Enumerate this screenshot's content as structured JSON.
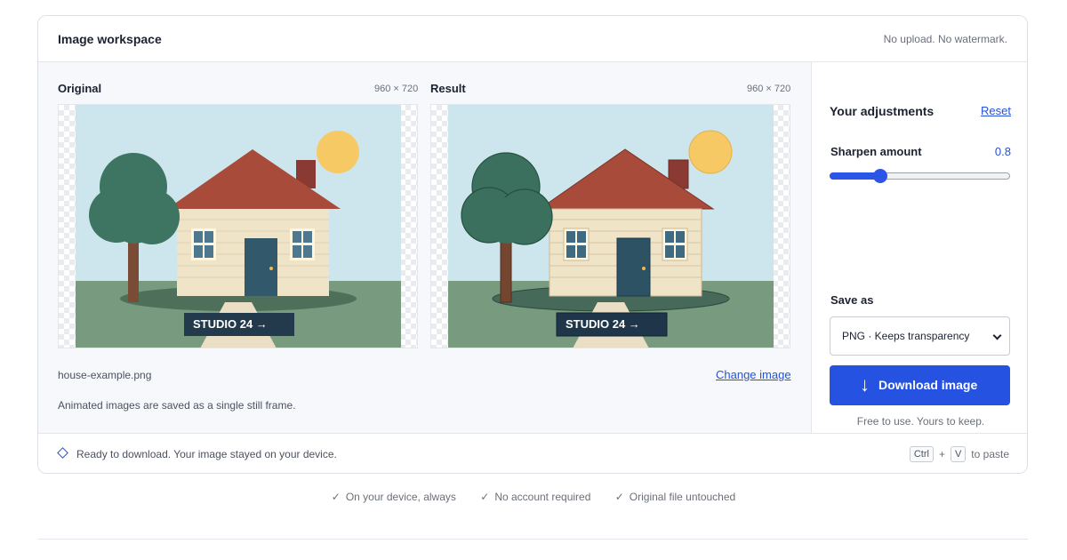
{
  "workspace": {
    "title": "Image workspace",
    "note": "No upload. No watermark."
  },
  "original": {
    "label": "Original",
    "dims": "960 × 720",
    "sign_text": "STUDIO 24 →"
  },
  "result": {
    "label": "Result",
    "dims": "960 × 720",
    "sign_text": "STUDIO 24 →"
  },
  "file": {
    "name": "house-example.png",
    "change_label": "Change image",
    "animated_note": "Animated images are saved as a single still frame."
  },
  "adjustments": {
    "title": "Your adjustments",
    "reset_label": "Reset",
    "sharpen_label": "Sharpen amount",
    "sharpen_value": "0.8",
    "sharpen_fraction": 0.28
  },
  "save": {
    "label": "Save as",
    "format_selected": "PNG · Keeps transparency",
    "download_label": "Download image",
    "free_note": "Free to use. Yours to keep."
  },
  "footer": {
    "status": "Ready to download. Your image stayed on your device.",
    "key_ctrl": "Ctrl",
    "key_plus": "+",
    "key_v": "V",
    "paste_text": "to paste"
  },
  "features": [
    {
      "text": "On your device, always"
    },
    {
      "text": "No account required"
    },
    {
      "text": "Original file untouched"
    }
  ],
  "colors": {
    "accent": "#2552e0",
    "sky": "#cde5ec",
    "grass": "#789a7e",
    "roof": "#a84b3b",
    "wall": "#efe3c8",
    "door": "#32586b",
    "tree": "#3d7562",
    "sun": "#f6c964"
  },
  "icons": {
    "status": "diamond-icon",
    "check": "check-icon",
    "download": "arrow-down-icon",
    "select": "chevron-down-icon"
  }
}
